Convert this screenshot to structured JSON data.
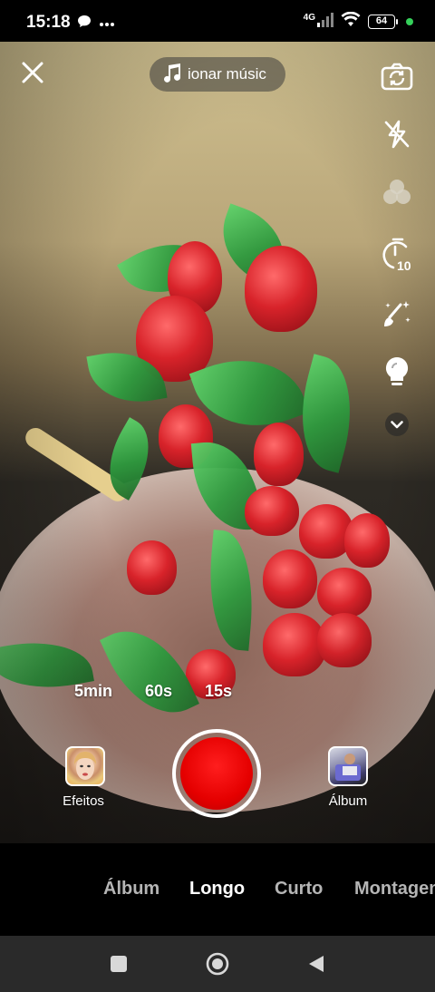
{
  "status_bar": {
    "time": "15:18",
    "network": "4G",
    "battery": "64",
    "icons": [
      "chat-bubble-icon",
      "more-dots-icon",
      "signal-icon",
      "wifi-icon",
      "battery-icon"
    ]
  },
  "top_bar": {
    "close_icon": "close-icon",
    "music_label": "ionar músic",
    "music_icon": "music-note-icon"
  },
  "right_rail": [
    "flip-camera-icon",
    "flash-off-icon",
    "filters-icon",
    "timer-10-icon",
    "beauty-icon",
    "lightbulb-icon",
    "chevron-down-icon"
  ],
  "timer_badge": "10",
  "durations": [
    "5min",
    "60s",
    "15s"
  ],
  "effects": {
    "label": "Efeitos"
  },
  "album": {
    "label": "Álbum"
  },
  "record": {
    "color": "#e50000"
  },
  "modes": [
    {
      "label": "Álbum",
      "active": false
    },
    {
      "label": "Longo",
      "active": true
    },
    {
      "label": "Curto",
      "active": false
    },
    {
      "label": "Montagem",
      "active": false
    }
  ],
  "nav": [
    "recents-square-icon",
    "home-circle-icon",
    "back-triangle-icon"
  ]
}
